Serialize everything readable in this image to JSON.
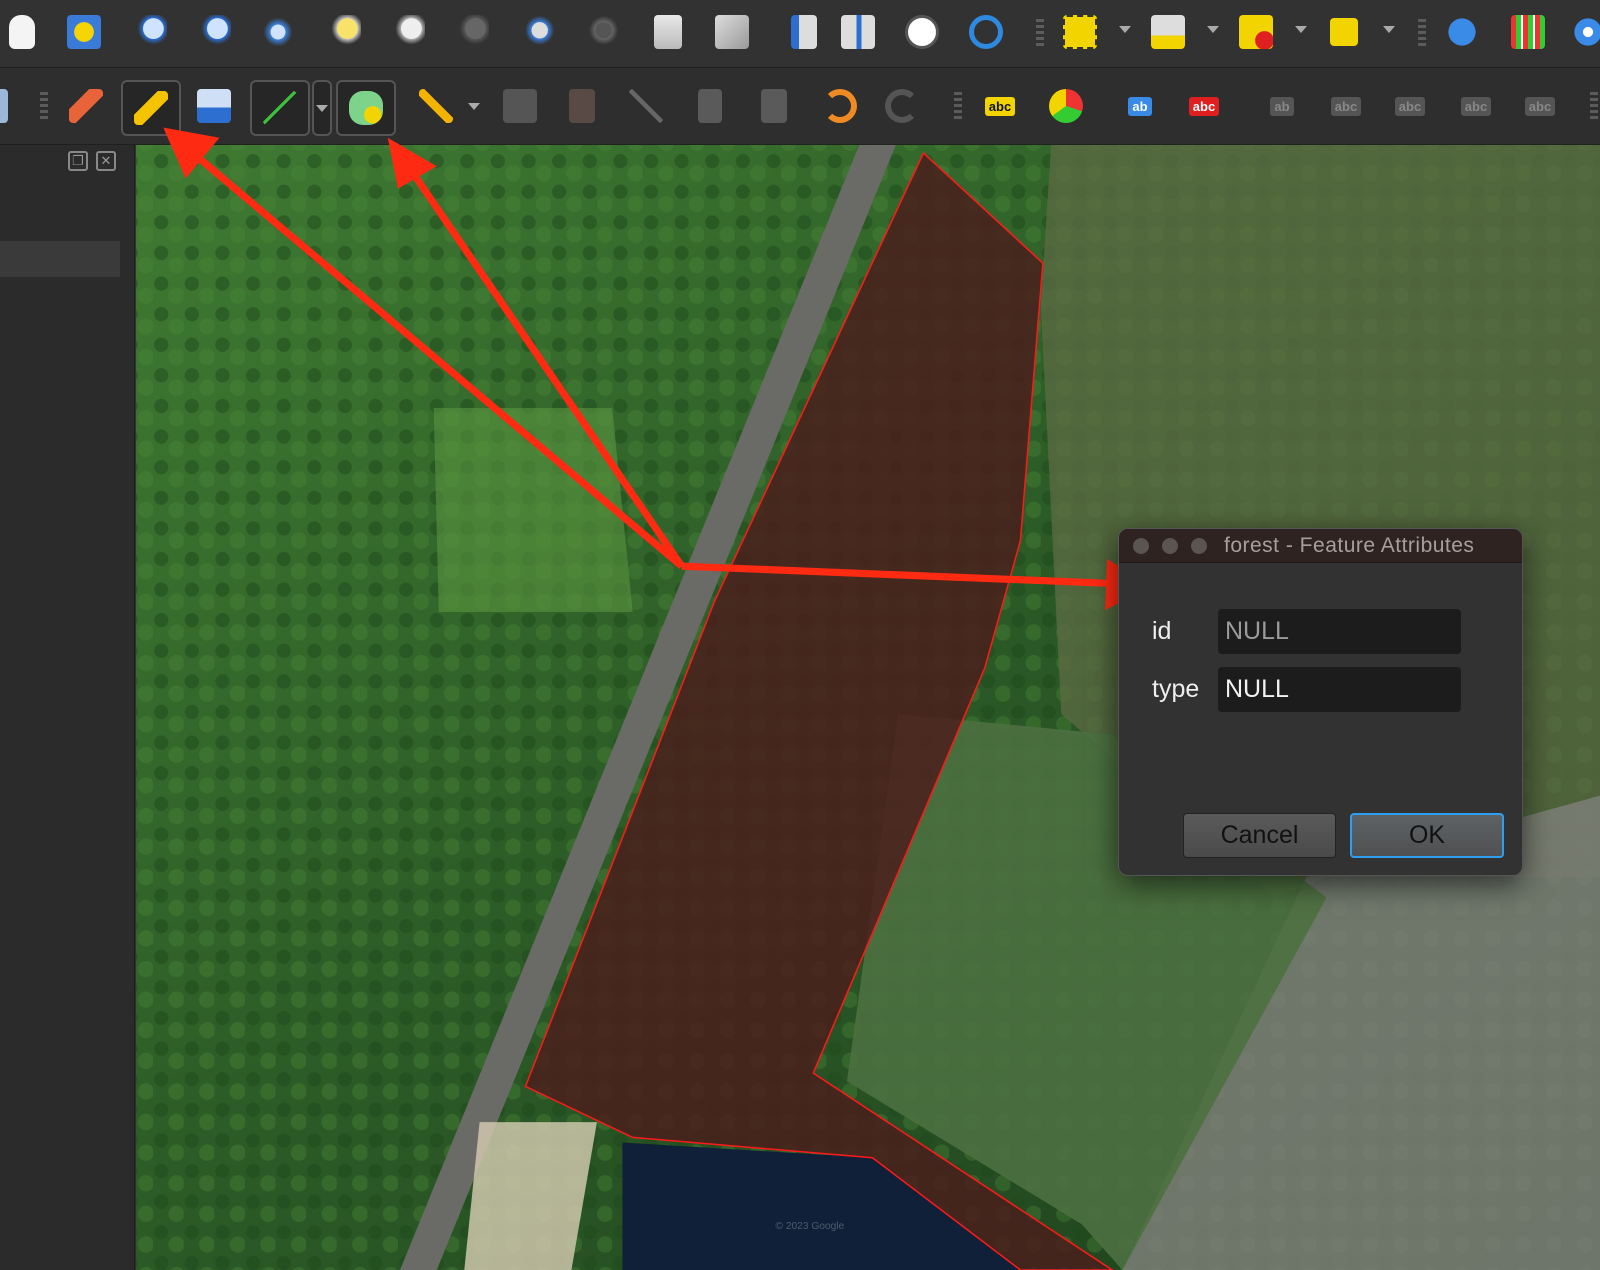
{
  "toolbar_top": {
    "icons": [
      "pan-hand-icon",
      "pan-to-selection-icon",
      "zoom-in-icon",
      "zoom-out-icon",
      "zoom-full-icon",
      "zoom-to-selection-icon",
      "zoom-to-layer-icon",
      "zoom-native-icon",
      "zoom-last-icon",
      "zoom-next-icon",
      "new-map-view-icon",
      "new-3d-map-view-icon",
      "new-spatial-bookmark-icon",
      "show-bookmarks-icon",
      "temporal-controller-icon",
      "refresh-icon",
      "select-features-icon",
      "open-attribute-table-icon",
      "deselect-all-icon",
      "select-by-location-icon",
      "identify-features-icon",
      "statistical-summary-icon",
      "settings-icon"
    ]
  },
  "toolbar_edit": {
    "labels": [
      "abc",
      "abc",
      "ab",
      "abc",
      "ab",
      "abc",
      "abc",
      "abc",
      "abc"
    ]
  },
  "dialog": {
    "title": "forest - Feature Attributes",
    "fields": [
      {
        "label": "id",
        "value": "NULL"
      },
      {
        "label": "type",
        "value": "NULL"
      }
    ],
    "cancel": "Cancel",
    "ok": "OK"
  },
  "map": {
    "attribution": "© 2023 Google",
    "colors": {
      "polygon_outline": "#ff1a1a",
      "arrow": "#ff2a12",
      "forest_tint": "#4a1f1c"
    }
  }
}
